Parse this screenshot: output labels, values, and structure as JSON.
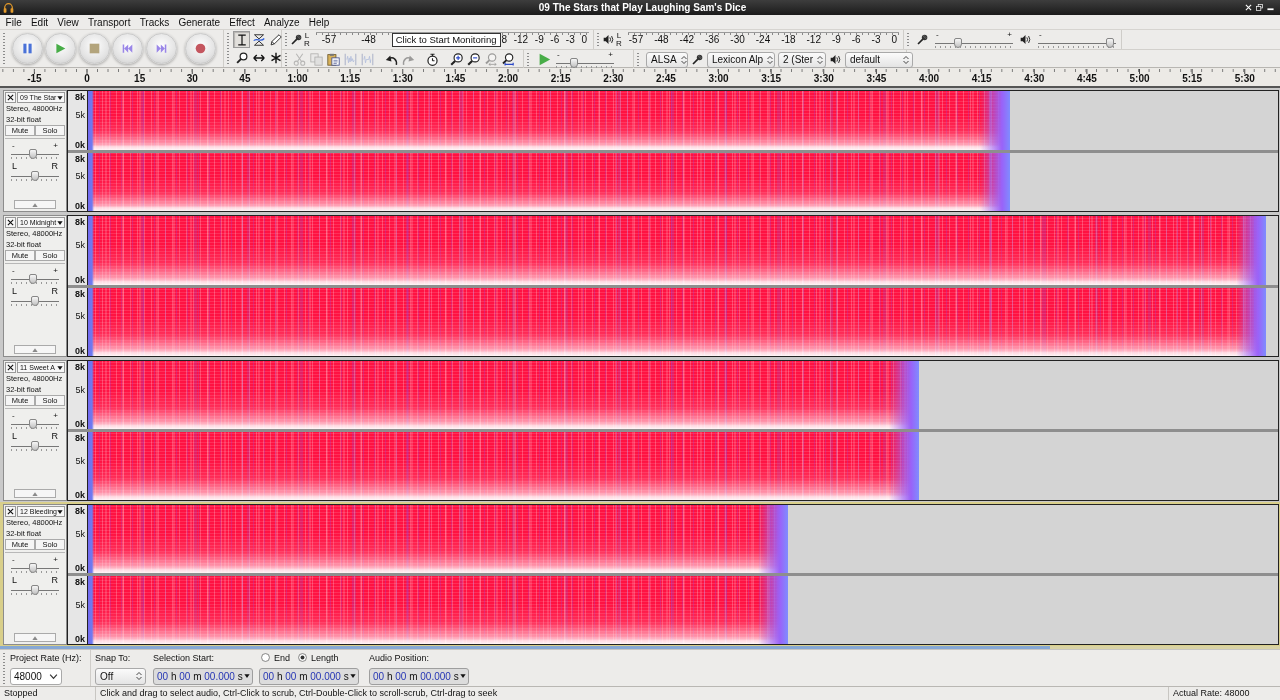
{
  "window": {
    "title": "09 The Stars that Play Laughing Sam's Dice"
  },
  "menu": [
    "File",
    "Edit",
    "View",
    "Transport",
    "Tracks",
    "Generate",
    "Effect",
    "Analyze",
    "Help"
  ],
  "tools": [
    {
      "selected": true
    },
    {
      "selected": false
    },
    {
      "selected": false
    },
    {
      "selected": false
    },
    {
      "selected": false
    },
    {
      "selected": false
    }
  ],
  "record_meter": {
    "channels": [
      "L",
      "R"
    ],
    "ticks_before": [
      "-57",
      "-48"
    ],
    "tooltip": "Click to Start Monitoring",
    "ticks_after": [
      "8",
      "-12",
      "-9",
      "-6",
      "-3",
      "0"
    ]
  },
  "playback_meter": {
    "channels": [
      "L",
      "R"
    ],
    "ticks": [
      "-57",
      "-48",
      "-42",
      "-36",
      "-30",
      "-24",
      "-18",
      "-12",
      "-9",
      "-6",
      "-3",
      "0"
    ]
  },
  "mixer": {
    "input_volume": {
      "min_label": "-",
      "max_label": "+",
      "level": 0.27
    },
    "output_volume": {
      "min_label": "-",
      "level": 0.97
    }
  },
  "edit_buttons": [
    {
      "disabled": true
    },
    {
      "disabled": true
    },
    {
      "disabled": false
    },
    {
      "disabled": true
    },
    {
      "disabled": true
    },
    {
      "disabled": false
    },
    {
      "disabled": true
    },
    {
      "disabled": false
    },
    {
      "disabled": false
    },
    {
      "disabled": false
    },
    {
      "disabled": true
    },
    {
      "disabled": false
    }
  ],
  "play_at_speed": {
    "min_label": "-",
    "max_label": "+",
    "level": 0.28
  },
  "devices": {
    "host": "ALSA",
    "input": "Lexicon Alp",
    "input_channels": "2 (Ster",
    "output": "default"
  },
  "ruler": [
    "-15",
    "0",
    "15",
    "30",
    "45",
    "1:00",
    "1:15",
    "1:30",
    "1:45",
    "2:00",
    "2:15",
    "2:30",
    "2:45",
    "3:00",
    "3:15",
    "3:30",
    "3:45",
    "4:00",
    "4:15",
    "4:30",
    "4:45",
    "5:00",
    "5:15",
    "5:30"
  ],
  "tracks": [
    {
      "name": "09 The Star",
      "format": "Stereo, 48000Hz",
      "sample_format": "32-bit float",
      "mute": "Mute",
      "solo": "Solo",
      "gain": {
        "min_label": "-",
        "max_label": "+",
        "level": 0.45
      },
      "pan": {
        "min_label": "L",
        "max_label": "R",
        "level": 0.5
      },
      "selected": false,
      "clip": {
        "level": 0.775
      },
      "channels": [
        {
          "scale": [
            "8k",
            "5k",
            "0k"
          ]
        },
        {
          "scale": [
            "8k",
            "5k",
            "0k"
          ]
        }
      ]
    },
    {
      "name": "10 Midnight",
      "format": "Stereo, 48000Hz",
      "sample_format": "32-bit float",
      "mute": "Mute",
      "solo": "Solo",
      "gain": {
        "min_label": "-",
        "max_label": "+",
        "level": 0.45
      },
      "pan": {
        "min_label": "L",
        "max_label": "R",
        "level": 0.5
      },
      "selected": false,
      "clip": {
        "level": 0.99
      },
      "channels": [
        {
          "scale": [
            "8k",
            "5k",
            "0k"
          ]
        },
        {
          "scale": [
            "8k",
            "5k",
            "0k"
          ]
        }
      ]
    },
    {
      "name": "11 Sweet A",
      "format": "Stereo, 48000Hz",
      "sample_format": "32-bit float",
      "mute": "Mute",
      "solo": "Solo",
      "gain": {
        "min_label": "-",
        "max_label": "+",
        "level": 0.45
      },
      "pan": {
        "min_label": "L",
        "max_label": "R",
        "level": 0.5
      },
      "selected": false,
      "clip": {
        "level": 0.698
      },
      "channels": [
        {
          "scale": [
            "8k",
            "5k",
            "0k"
          ]
        },
        {
          "scale": [
            "8k",
            "5k",
            "0k"
          ]
        }
      ]
    },
    {
      "name": "12 Bleeding",
      "format": "Stereo, 48000Hz",
      "sample_format": "32-bit float",
      "mute": "Mute",
      "solo": "Solo",
      "gain": {
        "min_label": "-",
        "max_label": "+",
        "level": 0.45
      },
      "pan": {
        "min_label": "L",
        "max_label": "R",
        "level": 0.5
      },
      "selected": true,
      "clip": {
        "level": 0.588
      },
      "channels": [
        {
          "scale": [
            "8k",
            "5k",
            "0k"
          ]
        },
        {
          "scale": [
            "8k",
            "5k",
            "0k"
          ]
        }
      ]
    }
  ],
  "selection_bar": {
    "project_rate_label": "Project Rate (Hz):",
    "project_rate": "48000",
    "snap_label": "Snap To:",
    "snap": "Off",
    "selection_start_label": "Selection Start:",
    "selection_start": "00 h 00 m 00.000 s",
    "modes": [
      {
        "label": "End",
        "selected": false
      },
      {
        "label": "Length",
        "selected": true
      }
    ],
    "length": "00 h 00 m 00.000 s",
    "audio_position_label": "Audio Position:",
    "audio_position": "00 h 00 m 00.000 s"
  },
  "status_bar": {
    "state": "Stopped",
    "hint": "Click and drag to select audio, Ctrl-Click to scrub, Ctrl-Double-Click to scroll-scrub, Ctrl-drag to seek",
    "rate": "Actual Rate: 48000"
  }
}
